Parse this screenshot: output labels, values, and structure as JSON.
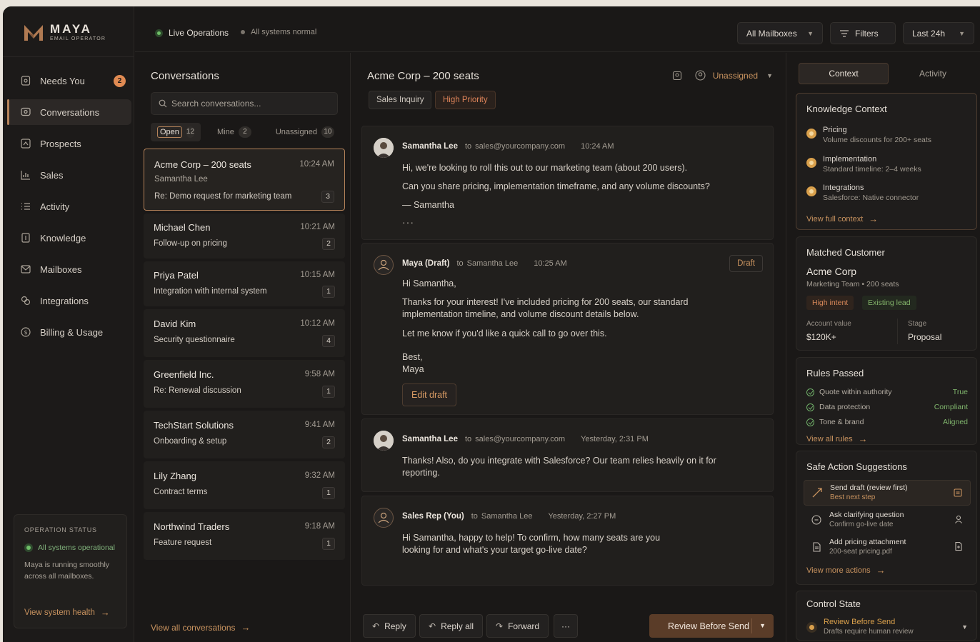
{
  "brand": {
    "name": "MAYA",
    "tagline": "EMAIL OPERATOR"
  },
  "nav": [
    {
      "label": "Needs You",
      "icon": "bell-icon",
      "badge": "2"
    },
    {
      "label": "Conversations",
      "icon": "chat-icon",
      "active": true
    },
    {
      "label": "Prospects",
      "icon": "prospects-icon"
    },
    {
      "label": "Sales",
      "icon": "chart-icon"
    },
    {
      "label": "Activity",
      "icon": "list-icon"
    },
    {
      "label": "Knowledge",
      "icon": "book-icon"
    },
    {
      "label": "Mailboxes",
      "icon": "mail-icon"
    },
    {
      "label": "Integrations",
      "icon": "puzzle-icon"
    },
    {
      "label": "Billing & Usage",
      "icon": "dollar-icon"
    }
  ],
  "op_status": {
    "title": "OPERATION STATUS",
    "status": "All systems operational",
    "desc": "Maya is running smoothly across all mailboxes.",
    "link": "View system health"
  },
  "topbar": {
    "live": "Live Operations",
    "systems": "All systems normal",
    "mailboxes": "All Mailboxes",
    "filters": "Filters",
    "range": "Last 24h"
  },
  "conversations": {
    "title": "Conversations",
    "search_placeholder": "Search conversations...",
    "filters": [
      {
        "label": "Open",
        "count": "12"
      },
      {
        "label": "Mine",
        "count": "2"
      },
      {
        "label": "Unassigned",
        "count": "10"
      }
    ],
    "items": [
      {
        "name": "Acme Corp – 200 seats",
        "time": "10:24 AM",
        "contact": "Samantha Lee",
        "subject": "Re: Demo request for marketing team",
        "count": "3"
      },
      {
        "name": "Michael Chen",
        "time": "10:21 AM",
        "subject": "Follow-up on pricing",
        "count": "2"
      },
      {
        "name": "Priya Patel",
        "time": "10:15 AM",
        "subject": "Integration with internal system",
        "count": "1"
      },
      {
        "name": "David Kim",
        "time": "10:12 AM",
        "subject": "Security questionnaire",
        "count": "4"
      },
      {
        "name": "Greenfield Inc.",
        "time": "9:58 AM",
        "subject": "Re: Renewal discussion",
        "count": "1"
      },
      {
        "name": "TechStart Solutions",
        "time": "9:41 AM",
        "subject": "Onboarding & setup",
        "count": "2"
      },
      {
        "name": "Lily Zhang",
        "time": "9:32 AM",
        "subject": "Contract terms",
        "count": "1"
      },
      {
        "name": "Northwind Traders",
        "time": "9:18 AM",
        "subject": "Feature request",
        "count": "1"
      }
    ],
    "view_all": "View all conversations"
  },
  "thread": {
    "title": "Acme Corp – 200 seats",
    "assignee": "Unassigned",
    "tags": [
      "Sales Inquiry",
      "High Priority"
    ],
    "messages": [
      {
        "from": "Samantha Lee",
        "to_label": "to",
        "to": "sales@yourcompany.com",
        "time": "10:24 AM",
        "lines": [
          "Hi, we're looking to roll this out to our marketing team (about 200 users).",
          "Can you share pricing, implementation timeframe, and any volume discounts?",
          "— Samantha"
        ],
        "more": "···"
      },
      {
        "from": "Maya (Draft)",
        "to_label": "to",
        "to": "Samantha Lee",
        "time": "10:25 AM",
        "badge": "Draft",
        "lines": [
          "Hi Samantha,",
          "Thanks for your interest! I've included pricing for 200 seats, our standard implementation timeline, and volume discount details below.",
          "Let me know if you'd like a quick call to go over this.",
          "Best,",
          "Maya"
        ],
        "edit": "Edit draft"
      },
      {
        "from": "Samantha Lee",
        "to_label": "to",
        "to": "sales@yourcompany.com",
        "time": "Yesterday, 2:31 PM",
        "lines": [
          "Thanks! Also, do you integrate with Salesforce? Our team relies heavily on it for reporting."
        ]
      },
      {
        "from": "Sales Rep (You)",
        "to_label": "to",
        "to": "Samantha Lee",
        "time": "Yesterday, 2:27 PM",
        "lines": [
          "Hi Samantha, happy to help! To confirm, how many seats are you looking for and what's your target go-live date?"
        ]
      }
    ],
    "actions": {
      "reply": "Reply",
      "reply_all": "Reply all",
      "forward": "Forward",
      "more": "···",
      "send": "Review Before Send"
    }
  },
  "panel": {
    "tabs": [
      "Context",
      "Activity"
    ],
    "knowledge": {
      "title": "Knowledge Context",
      "items": [
        {
          "label": "Pricing",
          "sub": "Volume discounts for 200+ seats"
        },
        {
          "label": "Implementation",
          "sub": "Standard timeline: 2–4 weeks"
        },
        {
          "label": "Integrations",
          "sub": "Salesforce: Native connector"
        }
      ],
      "link": "View full context"
    },
    "customer": {
      "title": "Matched Customer",
      "name": "Acme Corp",
      "sub": "Marketing Team • 200 seats",
      "chips": [
        "High intent",
        "Existing lead"
      ],
      "account_label": "Account value",
      "account_value": "$120K+",
      "stage_label": "Stage",
      "stage_value": "Proposal"
    },
    "rules": {
      "title": "Rules Passed",
      "items": [
        {
          "label": "Quote within authority",
          "value": "True"
        },
        {
          "label": "Data protection",
          "value": "Compliant"
        },
        {
          "label": "Tone & brand",
          "value": "Aligned"
        }
      ],
      "link": "View all rules"
    },
    "suggestions": {
      "title": "Safe Action Suggestions",
      "items": [
        {
          "title": "Send draft (review first)",
          "sub": "Best next step"
        },
        {
          "title": "Ask clarifying question",
          "sub": "Confirm go-live date"
        },
        {
          "title": "Add pricing attachment",
          "sub": "200-seat pricing.pdf"
        }
      ],
      "link": "View more actions"
    },
    "control": {
      "title": "Control State",
      "state": "Review Before Send",
      "sub": "Drafts require human review"
    }
  },
  "colors": {
    "accent": "#c9935f",
    "bg": "#1a1817",
    "success": "#6fbf68",
    "priority": "#e0855a"
  }
}
